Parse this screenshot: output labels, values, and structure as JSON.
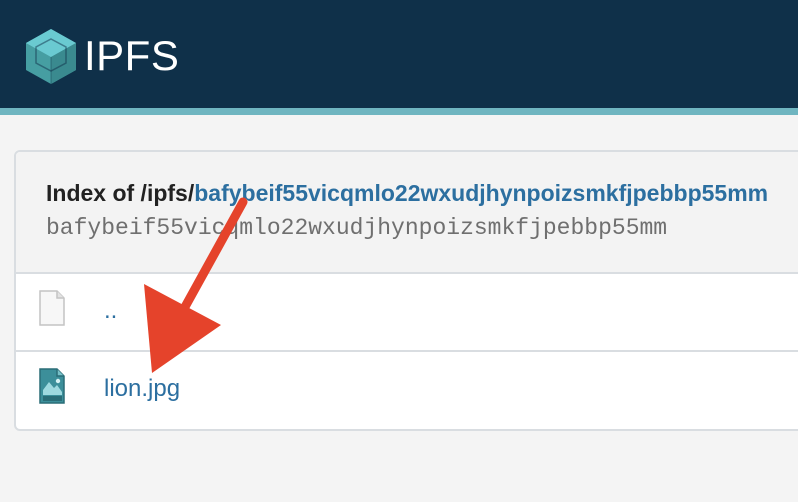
{
  "header": {
    "logo_text": "IPFS",
    "logo_icon": "ipfs-cube-icon",
    "background_color": "#0f3049",
    "accent_color": "#6fb5c0"
  },
  "listing": {
    "index_prefix": "Index of /ipfs/",
    "cid_link_text": "bafybeif55vicqmlo22wxudjhynpoizsmkfjpebbp55mm",
    "cid_full": "bafybeif55vicqmlo22wxudjhynpoizsmkfjpebbp55mm",
    "rows": [
      {
        "icon": "file-blank-icon",
        "label": ".."
      },
      {
        "icon": "file-jpg-icon",
        "label": "lion.jpg"
      }
    ],
    "link_color": "#2c6fa0"
  },
  "annotation": {
    "arrow_color": "#e5432b"
  }
}
